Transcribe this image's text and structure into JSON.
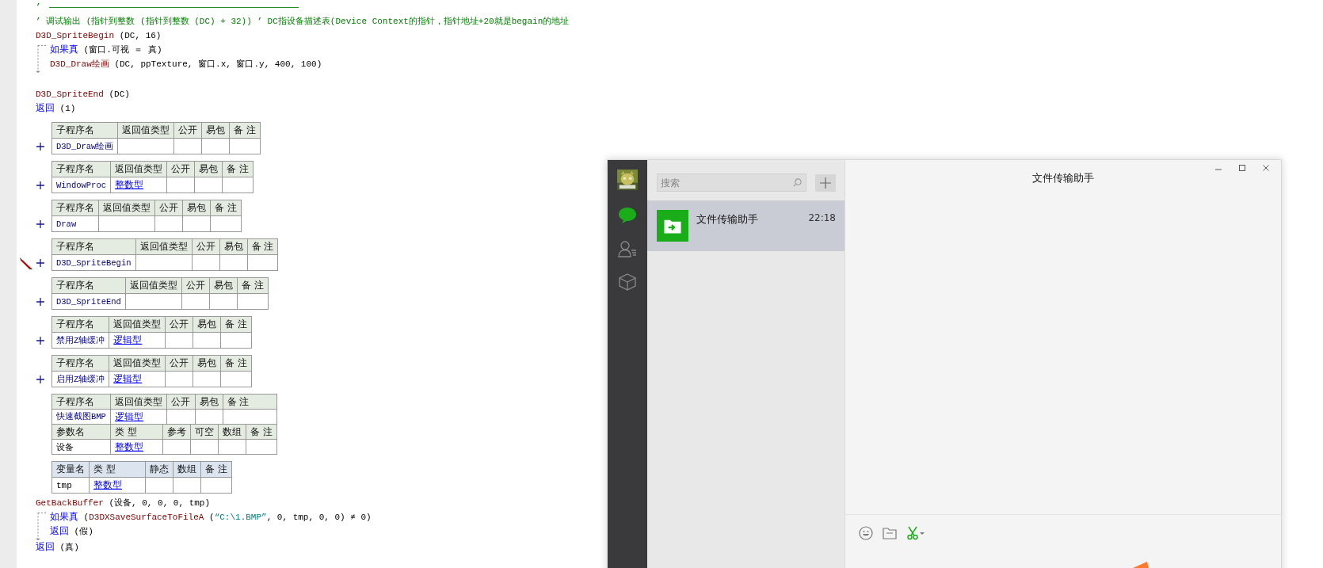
{
  "editor": {
    "blocks": [
      {
        "kind": "line",
        "rule": true,
        "segments": [
          {
            "kind": "comment",
            "text": "’"
          }
        ]
      },
      {
        "kind": "line",
        "segments": [
          {
            "kind": "comment",
            "text": "’ 调试输出 (指针到整数 (指针到整数 (DC) + 32)) ’ DC指设备描述表(Device Context的指针，指针地址+20就是begain的地址"
          }
        ]
      },
      {
        "kind": "line",
        "segments": [
          {
            "kind": "call",
            "text": "D3D_SpriteBegin"
          },
          {
            "kind": "plain",
            "text": " (DC, 16)"
          }
        ]
      },
      {
        "kind": "if",
        "segments": [
          {
            "kind": "keyword",
            "text": "如果真"
          },
          {
            "kind": "plain",
            "text": " (窗口.可视 ＝ 真)"
          }
        ],
        "body": [
          {
            "kind": "line",
            "segments": [
              {
                "kind": "call",
                "text": "D3D_Draw绘画"
              },
              {
                "kind": "plain",
                "text": " (DC, ppTexture, 窗口.x, 窗口.y, 400, 100)"
              }
            ]
          }
        ]
      },
      {
        "kind": "blank"
      },
      {
        "kind": "line",
        "segments": [
          {
            "kind": "call",
            "text": "D3D_SpriteEnd"
          },
          {
            "kind": "plain",
            "text": " (DC)"
          }
        ]
      },
      {
        "kind": "line",
        "segments": [
          {
            "kind": "keyword",
            "text": "返回"
          },
          {
            "kind": "plain",
            "text": " (1)"
          }
        ]
      },
      {
        "kind": "table",
        "expandable": true,
        "marked": false,
        "rows": [
          {
            "kind": "header",
            "cells": [
              {
                "text": "子程序名"
              },
              {
                "text": "返回值类型"
              },
              {
                "text": "公开"
              },
              {
                "text": "易包"
              },
              {
                "text": "备 注"
              }
            ]
          },
          {
            "kind": "data",
            "cells": [
              {
                "kind": "name",
                "text": "D3D_Draw绘画"
              },
              {
                "kind": "empty"
              },
              {
                "kind": "empty"
              },
              {
                "kind": "empty"
              },
              {
                "kind": "empty"
              }
            ]
          }
        ]
      },
      {
        "kind": "table",
        "expandable": true,
        "marked": false,
        "rows": [
          {
            "kind": "header",
            "cells": [
              {
                "text": "子程序名"
              },
              {
                "text": "返回值类型"
              },
              {
                "text": "公开"
              },
              {
                "text": "易包"
              },
              {
                "text": "备 注"
              }
            ]
          },
          {
            "kind": "data",
            "cells": [
              {
                "kind": "name",
                "text": "WindowProc"
              },
              {
                "kind": "type",
                "text": "整数型"
              },
              {
                "kind": "empty"
              },
              {
                "kind": "empty"
              },
              {
                "kind": "empty"
              }
            ]
          }
        ]
      },
      {
        "kind": "table",
        "expandable": true,
        "marked": false,
        "rows": [
          {
            "kind": "header",
            "cells": [
              {
                "text": "子程序名"
              },
              {
                "text": "返回值类型"
              },
              {
                "text": "公开"
              },
              {
                "text": "易包"
              },
              {
                "text": "备 注"
              }
            ]
          },
          {
            "kind": "data",
            "cells": [
              {
                "kind": "name",
                "text": "Draw"
              },
              {
                "kind": "empty"
              },
              {
                "kind": "empty"
              },
              {
                "kind": "empty"
              },
              {
                "kind": "empty"
              }
            ]
          }
        ]
      },
      {
        "kind": "table",
        "expandable": true,
        "marked": true,
        "rows": [
          {
            "kind": "header",
            "cells": [
              {
                "text": "子程序名"
              },
              {
                "text": "返回值类型"
              },
              {
                "text": "公开"
              },
              {
                "text": "易包"
              },
              {
                "text": "备 注"
              }
            ]
          },
          {
            "kind": "data",
            "cells": [
              {
                "kind": "name",
                "text": "D3D_SpriteBegin"
              },
              {
                "kind": "empty"
              },
              {
                "kind": "empty"
              },
              {
                "kind": "empty"
              },
              {
                "kind": "empty"
              }
            ]
          }
        ]
      },
      {
        "kind": "table",
        "expandable": true,
        "marked": false,
        "rows": [
          {
            "kind": "header",
            "cells": [
              {
                "text": "子程序名"
              },
              {
                "text": "返回值类型"
              },
              {
                "text": "公开"
              },
              {
                "text": "易包"
              },
              {
                "text": "备 注"
              }
            ]
          },
          {
            "kind": "data",
            "cells": [
              {
                "kind": "name",
                "text": "D3D_SpriteEnd"
              },
              {
                "kind": "empty"
              },
              {
                "kind": "empty"
              },
              {
                "kind": "empty"
              },
              {
                "kind": "empty"
              }
            ]
          }
        ]
      },
      {
        "kind": "table",
        "expandable": true,
        "marked": false,
        "rows": [
          {
            "kind": "header",
            "cells": [
              {
                "text": "子程序名"
              },
              {
                "text": "返回值类型"
              },
              {
                "text": "公开"
              },
              {
                "text": "易包"
              },
              {
                "text": "备 注"
              }
            ]
          },
          {
            "kind": "data",
            "cells": [
              {
                "kind": "name",
                "text": "禁用Z轴缓冲"
              },
              {
                "kind": "type",
                "text": "逻辑型"
              },
              {
                "kind": "empty"
              },
              {
                "kind": "empty"
              },
              {
                "kind": "empty"
              }
            ]
          }
        ]
      },
      {
        "kind": "table",
        "expandable": true,
        "marked": false,
        "rows": [
          {
            "kind": "header",
            "cells": [
              {
                "text": "子程序名"
              },
              {
                "text": "返回值类型"
              },
              {
                "text": "公开"
              },
              {
                "text": "易包"
              },
              {
                "text": "备 注"
              }
            ]
          },
          {
            "kind": "data",
            "cells": [
              {
                "kind": "name",
                "text": "启用Z轴缓冲"
              },
              {
                "kind": "type",
                "text": "逻辑型"
              },
              {
                "kind": "empty"
              },
              {
                "kind": "empty"
              },
              {
                "kind": "empty"
              }
            ]
          }
        ]
      },
      {
        "kind": "table",
        "expandable": false,
        "marked": false,
        "rows": [
          {
            "kind": "header",
            "cells": [
              {
                "text": "子程序名"
              },
              {
                "text": "返回值类型"
              },
              {
                "text": "公开"
              },
              {
                "text": "易包"
              },
              {
                "text": "备 注"
              }
            ]
          },
          {
            "kind": "data",
            "cells": [
              {
                "kind": "name",
                "text": "快速截图BMP"
              },
              {
                "kind": "type",
                "text": "逻辑型"
              },
              {
                "kind": "empty"
              },
              {
                "kind": "empty"
              },
              {
                "kind": "empty"
              }
            ]
          }
        ],
        "params": [
          {
            "kind": "header",
            "cells": [
              {
                "text": "参数名"
              },
              {
                "text": "类 型"
              },
              {
                "text": "参考"
              },
              {
                "text": "可空"
              },
              {
                "text": "数组"
              },
              {
                "text": "备 注"
              }
            ]
          },
          {
            "kind": "data",
            "cells": [
              {
                "kind": "plain",
                "text": "设备"
              },
              {
                "kind": "type",
                "text": "整数型"
              },
              {
                "kind": "empty"
              },
              {
                "kind": "empty"
              },
              {
                "kind": "empty"
              },
              {
                "kind": "empty"
              }
            ]
          }
        ]
      },
      {
        "kind": "table",
        "expandable": false,
        "marked": false,
        "rows": [
          {
            "kind": "var-header",
            "cells": [
              {
                "text": "变量名"
              },
              {
                "text": "类 型"
              },
              {
                "text": "静态"
              },
              {
                "text": "数组"
              },
              {
                "text": "备 注"
              }
            ]
          },
          {
            "kind": "data",
            "cells": [
              {
                "kind": "plain",
                "text": "tmp"
              },
              {
                "kind": "type",
                "text": "整数型"
              },
              {
                "kind": "empty"
              },
              {
                "kind": "empty"
              },
              {
                "kind": "empty"
              }
            ]
          }
        ]
      },
      {
        "kind": "line",
        "segments": [
          {
            "kind": "call",
            "text": "GetBackBuffer"
          },
          {
            "kind": "plain",
            "text": " (设备, 0, 0, 0, tmp)"
          }
        ]
      },
      {
        "kind": "if",
        "segments": [
          {
            "kind": "keyword",
            "text": "如果真"
          },
          {
            "kind": "plain",
            "text": " ("
          },
          {
            "kind": "call",
            "text": "D3DXSaveSurfaceToFileA"
          },
          {
            "kind": "plain",
            "text": " ("
          },
          {
            "kind": "string",
            "text": "“C:\\1.BMP”"
          },
          {
            "kind": "plain",
            "text": ", 0, tmp, 0, 0) ≠ 0)"
          }
        ],
        "body": [
          {
            "kind": "line",
            "segments": [
              {
                "kind": "keyword",
                "text": "返回"
              },
              {
                "kind": "plain",
                "text": " (假)"
              }
            ]
          }
        ]
      },
      {
        "kind": "line",
        "segments": [
          {
            "kind": "keyword",
            "text": "返回"
          },
          {
            "kind": "plain",
            "text": " (真)"
          }
        ]
      }
    ]
  },
  "chat_app": {
    "nav": [
      {
        "kind": "chats",
        "selected": true
      },
      {
        "kind": "contacts",
        "selected": false
      },
      {
        "kind": "favorites",
        "selected": false
      }
    ],
    "search": {
      "placeholder": "搜索"
    },
    "conversations": [
      {
        "name": "文件传输助手",
        "time": "22:18",
        "selected": true
      }
    ],
    "chat": {
      "title": "文件传输助手"
    },
    "toolbar": [
      {
        "kind": "emoji"
      },
      {
        "kind": "folder"
      },
      {
        "kind": "screenshot"
      }
    ]
  }
}
